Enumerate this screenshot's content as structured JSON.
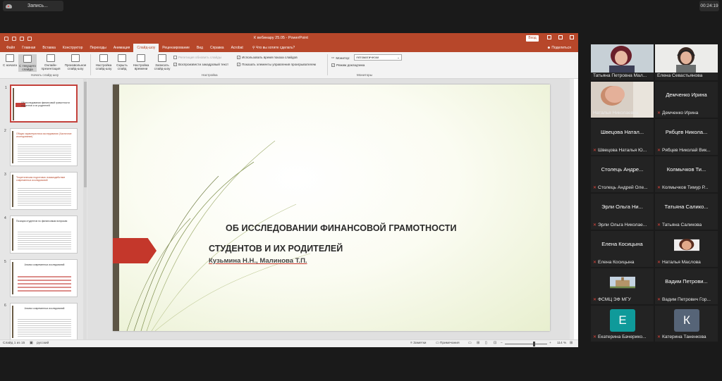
{
  "zoom": {
    "record_label": "Запись...",
    "elapsed": "00:24:19"
  },
  "ppt": {
    "window_title": "К вебинару 25.05 - PowerPoint",
    "enter_label": "Вход",
    "tabs": [
      "Файл",
      "Главная",
      "Вставка",
      "Конструктор",
      "Переходы",
      "Анимация",
      "Слайд-шоу",
      "Рецензирование",
      "Вид",
      "Справка",
      "Acrobat"
    ],
    "active_tab": "Слайд-шоу",
    "tell_me": "Что вы хотите сделать?",
    "share": "Поделиться",
    "ribbon": {
      "buttons": [
        {
          "label": "С начала"
        },
        {
          "label": "С текущего слайда"
        },
        {
          "label": "Онлайн-презентация"
        },
        {
          "label": "Произвольное слайд-шоу"
        },
        {
          "label": "Настройка слайд-шоу"
        },
        {
          "label": "Скрыть слайд"
        },
        {
          "label": "Настройка времени"
        },
        {
          "label": "Записать слайд-шоу"
        }
      ],
      "checks": [
        {
          "label": "Репетиция обновить слайды",
          "checked": false,
          "disabled": true
        },
        {
          "label": "Воспроизвести закадровый текст",
          "checked": true,
          "disabled": false
        },
        {
          "label": "Использовать время показа слайдов",
          "checked": true,
          "disabled": false
        },
        {
          "label": "Показать элементы управления проигрывателем",
          "checked": true,
          "disabled": false
        }
      ],
      "monitor_label": "Монитор:",
      "monitor_value": "Автоматически",
      "presenter_view": "Режим докладчика",
      "groups": [
        "Начать слайд-шоу",
        "Настройка",
        "Мониторы"
      ]
    },
    "thumbnails": [
      {
        "num": "1",
        "text": "Об исследовании финансовой грамотности студентов и их родителей"
      },
      {
        "num": "2",
        "text": "Общая характеристика исследования (Частичное исследование)"
      },
      {
        "num": "3",
        "text": "Теоретическая подготовка: взаимодействие современных исследований"
      },
      {
        "num": "4",
        "text": "Позиция студентов по финансовым вопросам"
      },
      {
        "num": "5",
        "text": "Анализ современных исследований"
      },
      {
        "num": "6",
        "text": "Анализ современных исследований"
      }
    ],
    "slide": {
      "title_line1": "ОБ ИССЛЕДОВАНИИ ФИНАНСОВОЙ ГРАМОТНОСТИ",
      "title_line2": "СТУДЕНТОВ И ИХ РОДИТЕЛЕЙ",
      "authors": "Кузьмина Н.Н., Малинова Т.П."
    },
    "status": {
      "slide_info": "Слайд 1 из 15",
      "language": "русский",
      "notes": "Заметки",
      "comments": "Примечания",
      "zoom": "114 %"
    }
  },
  "participants": [
    {
      "name": "Татьяна Петровна Мал...",
      "big": "",
      "photo": true,
      "muted": false
    },
    {
      "name": "Елена Севастьянова",
      "big": "",
      "photo": true,
      "muted": false
    },
    {
      "name": "Наталья Николаевна",
      "big": "",
      "photo": true,
      "muted": false,
      "active": true
    },
    {
      "name": "Демченко Ирина",
      "big": "Демченко Ирина",
      "photo": false,
      "muted": true
    },
    {
      "name": "Швецова Наталья Ю...",
      "big": "Швецова Натал...",
      "photo": false,
      "muted": true
    },
    {
      "name": "Рябцев Николай Вик...",
      "big": "Рябцев Никола...",
      "photo": false,
      "muted": true
    },
    {
      "name": "Столець Андрей Оле...",
      "big": "Столець Андре...",
      "photo": false,
      "muted": true
    },
    {
      "name": "Колмычков Тимур Р...",
      "big": "Колмычков Ти...",
      "photo": false,
      "muted": true
    },
    {
      "name": "Эрли Ольга Николае...",
      "big": "Эрли Ольга Ни...",
      "photo": false,
      "muted": true
    },
    {
      "name": "Татьяна Саликова",
      "big": "Татьяна Салико...",
      "photo": false,
      "muted": true
    },
    {
      "name": "Елена Косицына",
      "big": "Елена Косицына",
      "photo": false,
      "muted": true
    },
    {
      "name": "Наталья Маслова",
      "big": "",
      "photo": true,
      "muted": true
    },
    {
      "name": "ФСМЦ ЭФ МГУ",
      "big": "",
      "photo": true,
      "muted": true
    },
    {
      "name": "Вадим Петрович Гор...",
      "big": "Вадим Петрови...",
      "photo": false,
      "muted": true
    },
    {
      "name": "Екатерина Бачерико...",
      "big": "",
      "avatar": "Е",
      "muted": true
    },
    {
      "name": "Катерина Таненкова",
      "big": "",
      "avatar": "К",
      "muted": true
    }
  ],
  "colors": {
    "ppt_accent": "#b7472a",
    "slide_accent": "#c4372b",
    "active_speaker": "#b6d33a",
    "muted_icon": "#e0463c",
    "avatar_e": "#0f9a9a",
    "avatar_k": "#566477"
  }
}
